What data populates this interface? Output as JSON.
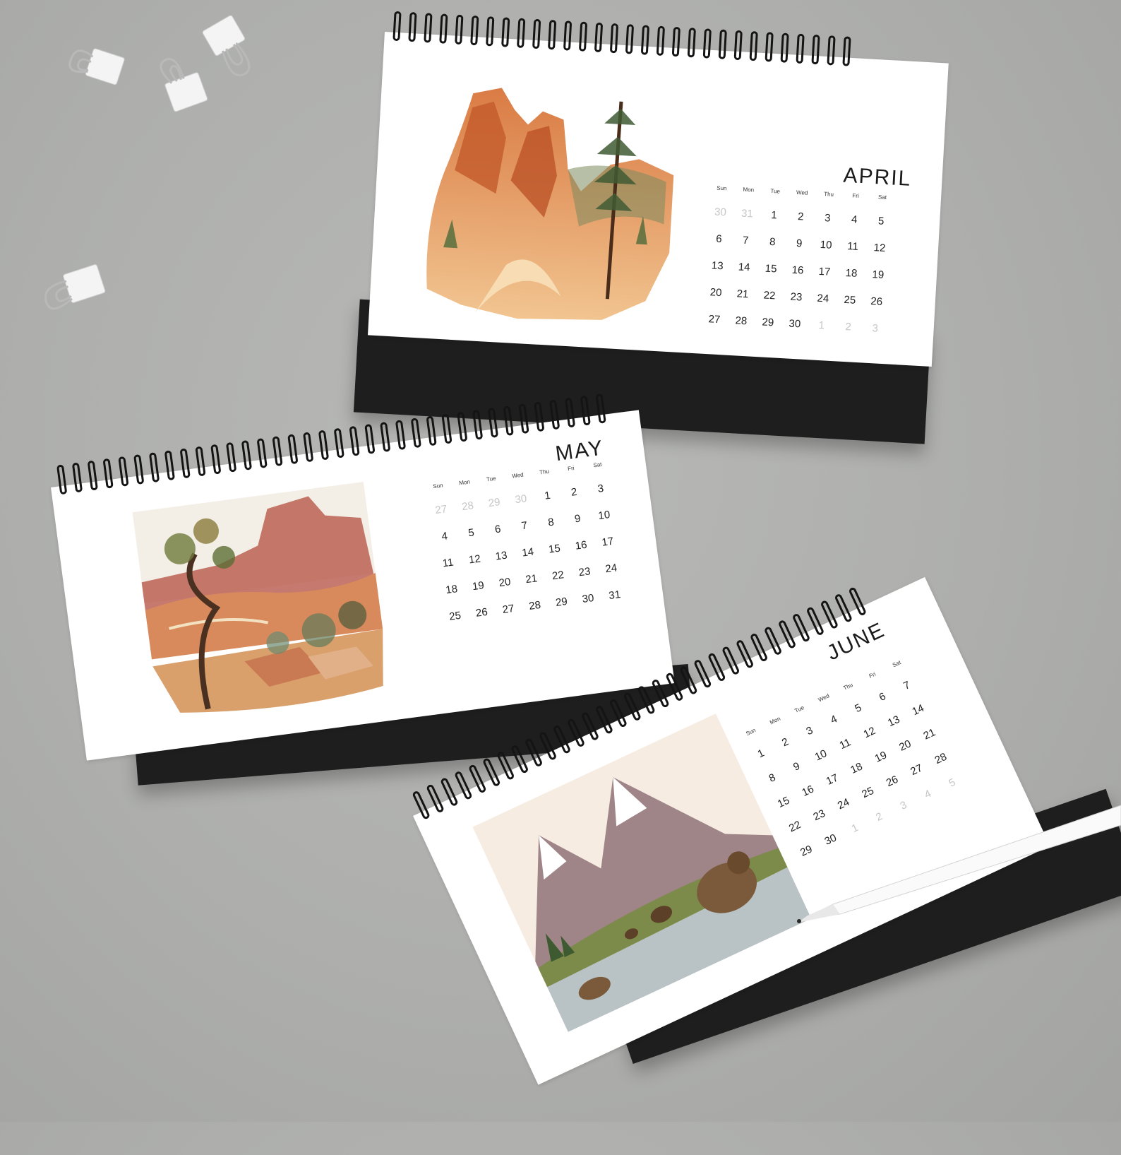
{
  "calendars": [
    {
      "id": "april",
      "month": "APRIL",
      "weekdays": [
        "Sun",
        "Mon",
        "Tue",
        "Wed",
        "Thu",
        "Fri",
        "Sat"
      ],
      "days": [
        "30",
        "31",
        "1",
        "2",
        "3",
        "4",
        "5",
        "6",
        "7",
        "8",
        "9",
        "10",
        "11",
        "12",
        "13",
        "14",
        "15",
        "16",
        "17",
        "18",
        "19",
        "20",
        "21",
        "22",
        "23",
        "24",
        "25",
        "26",
        "27",
        "28",
        "29",
        "30",
        "1",
        "2",
        "3"
      ],
      "muted": [
        0,
        1,
        32,
        33,
        34
      ],
      "illustration": "hoodoo-canyon-watercolor"
    },
    {
      "id": "may",
      "month": "MAY",
      "weekdays": [
        "Sun",
        "Mon",
        "Tue",
        "Wed",
        "Thu",
        "Fri",
        "Sat"
      ],
      "days": [
        "27",
        "28",
        "29",
        "30",
        "1",
        "2",
        "3",
        "4",
        "5",
        "6",
        "7",
        "8",
        "9",
        "10",
        "11",
        "12",
        "13",
        "14",
        "15",
        "16",
        "17",
        "18",
        "19",
        "20",
        "21",
        "22",
        "23",
        "24",
        "25",
        "26",
        "27",
        "28",
        "29",
        "30",
        "31"
      ],
      "muted": [
        0,
        1,
        2,
        3
      ],
      "illustration": "canyon-overlook-tree-watercolor"
    },
    {
      "id": "june",
      "month": "JUNE",
      "weekdays": [
        "Sun",
        "Mon",
        "Tue",
        "Wed",
        "Thu",
        "Fri",
        "Sat"
      ],
      "days": [
        "1",
        "2",
        "3",
        "4",
        "5",
        "6",
        "7",
        "8",
        "9",
        "10",
        "11",
        "12",
        "13",
        "14",
        "15",
        "16",
        "17",
        "18",
        "19",
        "20",
        "21",
        "22",
        "23",
        "24",
        "25",
        "26",
        "27",
        "28",
        "29",
        "30",
        "1",
        "2",
        "3",
        "4",
        "5"
      ],
      "muted": [
        30,
        31,
        32,
        33,
        34
      ],
      "illustration": "mountain-lake-bears-watercolor"
    }
  ],
  "props": {
    "binder_clips": 4,
    "pen": "white-pen"
  },
  "colors": {
    "desk": "#aeafad",
    "stand": "#1e1e1e",
    "page": "#ffffff",
    "coil": "#141414"
  }
}
